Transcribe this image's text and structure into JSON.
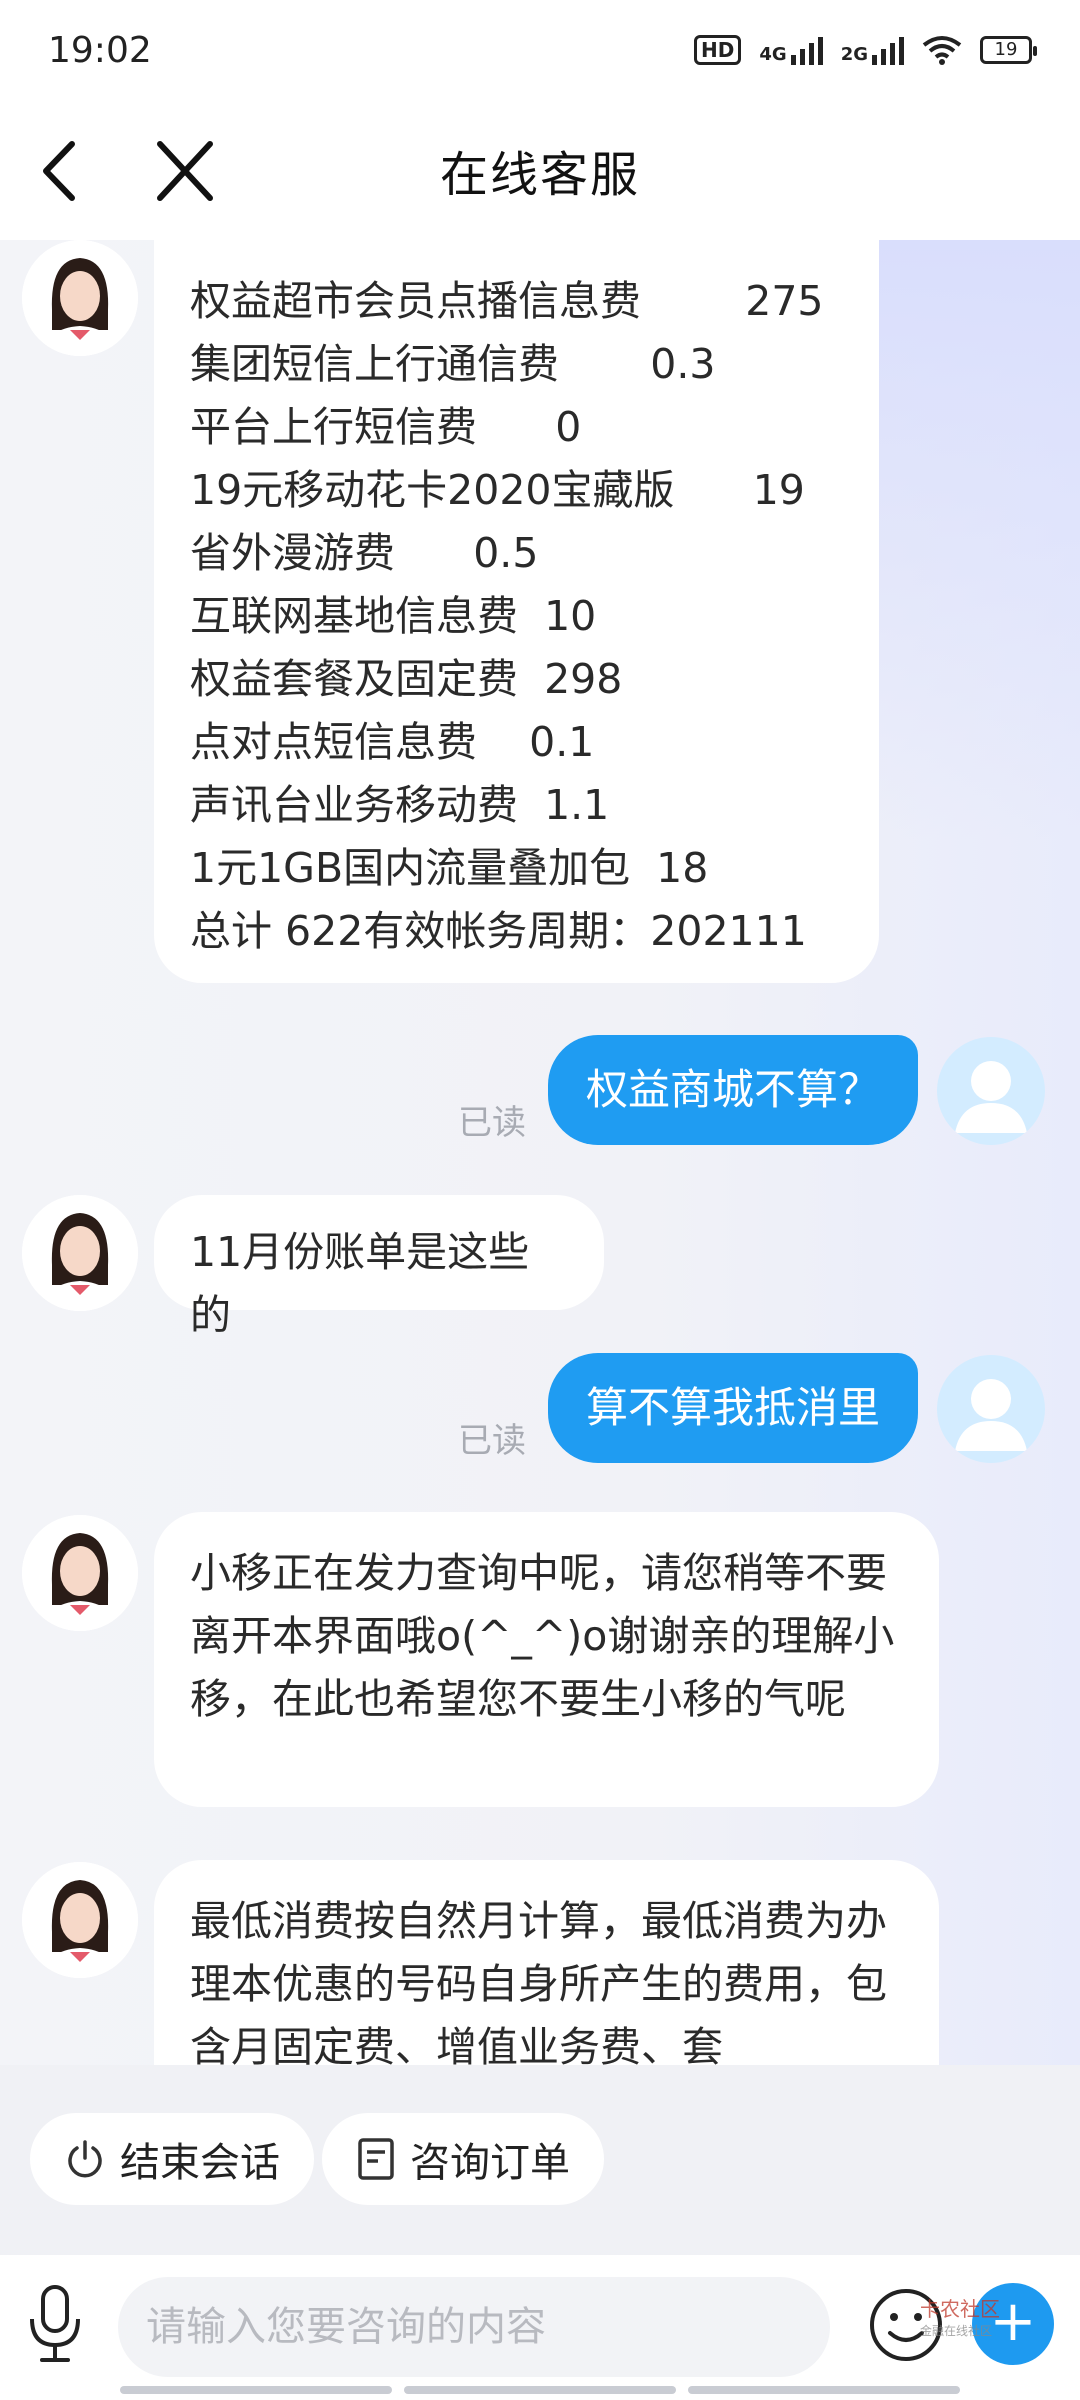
{
  "status_bar": {
    "time": "19:02",
    "hd_label": "HD",
    "net1": "4G",
    "net2": "2G",
    "battery": "19"
  },
  "header": {
    "title": "在线客服",
    "back_icon": "chevron-left-icon",
    "close_icon": "close-icon"
  },
  "messages": {
    "bill": {
      "rows": [
        "权益超市会员点播信息费        275",
        "集团短信上行通信费       0.3",
        "平台上行短信费      0",
        "19元移动花卡2020宝藏版      19",
        "省外漫游费      0.5",
        "互联网基地信息费  10",
        "权益套餐及固定费  298",
        "点对点短信息费    0.1",
        "声讯台业务移动费  1.1",
        "1元1GB国内流量叠加包  18",
        "总计 622有效帐务周期：202111"
      ]
    },
    "user1": {
      "text": "权益商城不算？",
      "read": "已读"
    },
    "agent2": {
      "text": "11月份账单是这些的"
    },
    "user2": {
      "text": "算不算我抵消里",
      "read": "已读"
    },
    "agent3": {
      "text": "小移正在发力查询中呢，请您稍等不要离开本界面哦o(^_^)o谢谢亲的理解小移，在此也希望您不要生小移的气呢"
    },
    "agent4": {
      "text": "最低消费按自然月计算，最低消费为办理本优惠的号码自身所产生的费用，包含月固定费、增值业务费、套"
    }
  },
  "quick_actions": {
    "end_chat": "结束会话",
    "order_query": "咨询订单"
  },
  "input": {
    "placeholder": "请输入您要咨询的内容",
    "plus": "+"
  },
  "watermark": {
    "text": "卡农社区",
    "sub": "金融在线社区"
  },
  "colors": {
    "user_bubble": "#1f9cf2",
    "agent_bubble": "#ffffff",
    "plus_button": "#1e9af0"
  }
}
